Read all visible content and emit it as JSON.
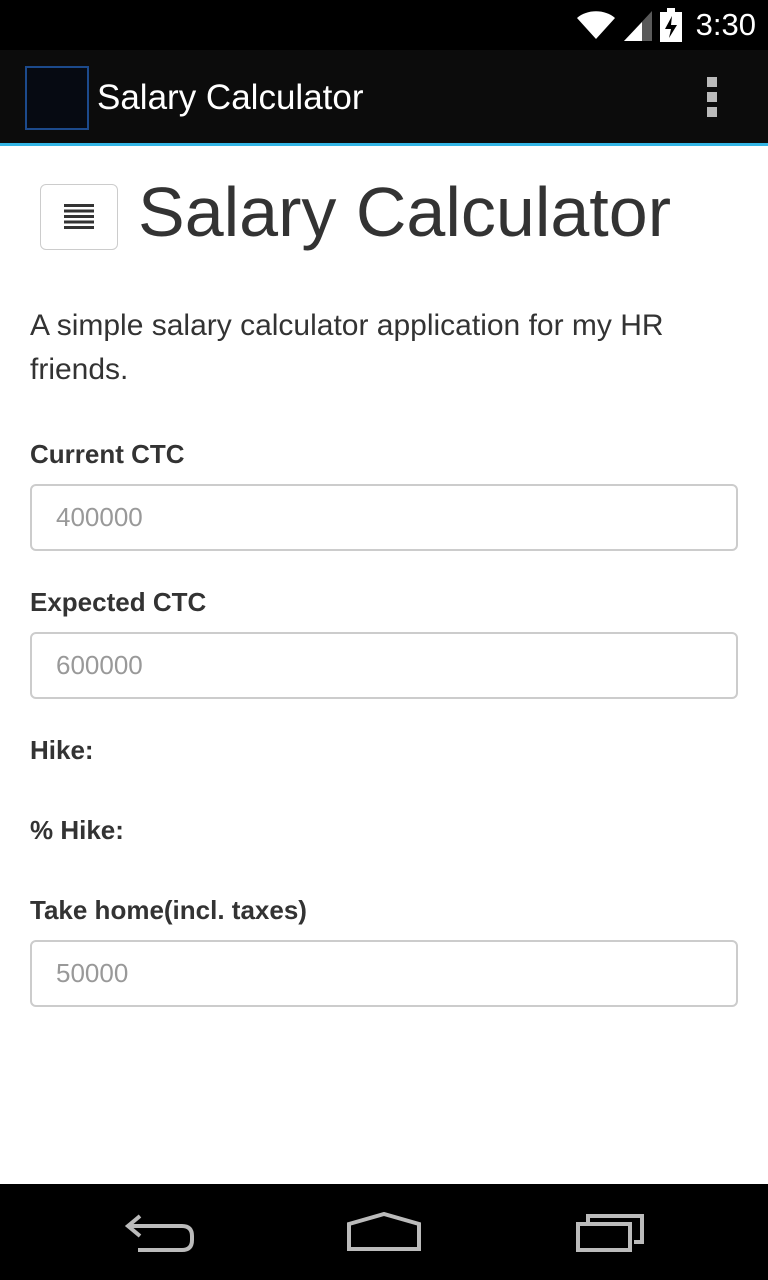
{
  "status_bar": {
    "time": "3:30",
    "icons": [
      "wifi-icon",
      "cell-signal-icon",
      "battery-charging-icon"
    ]
  },
  "action_bar": {
    "title": "Salary Calculator",
    "overflow_icon": "overflow-menu-icon"
  },
  "page": {
    "title": "Salary Calculator",
    "menu_icon": "hamburger-menu-icon",
    "description": "A simple salary calculator application for my HR friends."
  },
  "form": {
    "current_ctc": {
      "label": "Current CTC",
      "placeholder": "400000",
      "value": ""
    },
    "expected_ctc": {
      "label": "Expected CTC",
      "placeholder": "600000",
      "value": ""
    },
    "hike_label": "Hike:",
    "percent_hike_label": "% Hike:",
    "take_home": {
      "label": "Take home(incl. taxes)",
      "placeholder": "50000",
      "value": ""
    }
  },
  "nav_bar": {
    "icons": [
      "back-icon",
      "home-icon",
      "recent-apps-icon"
    ]
  },
  "colors": {
    "accent": "#33b5e5",
    "status_bar_bg": "#000000",
    "action_bar_bg": "#0c0c0c",
    "text": "#333333",
    "input_border": "#cccccc",
    "placeholder": "#999999"
  }
}
